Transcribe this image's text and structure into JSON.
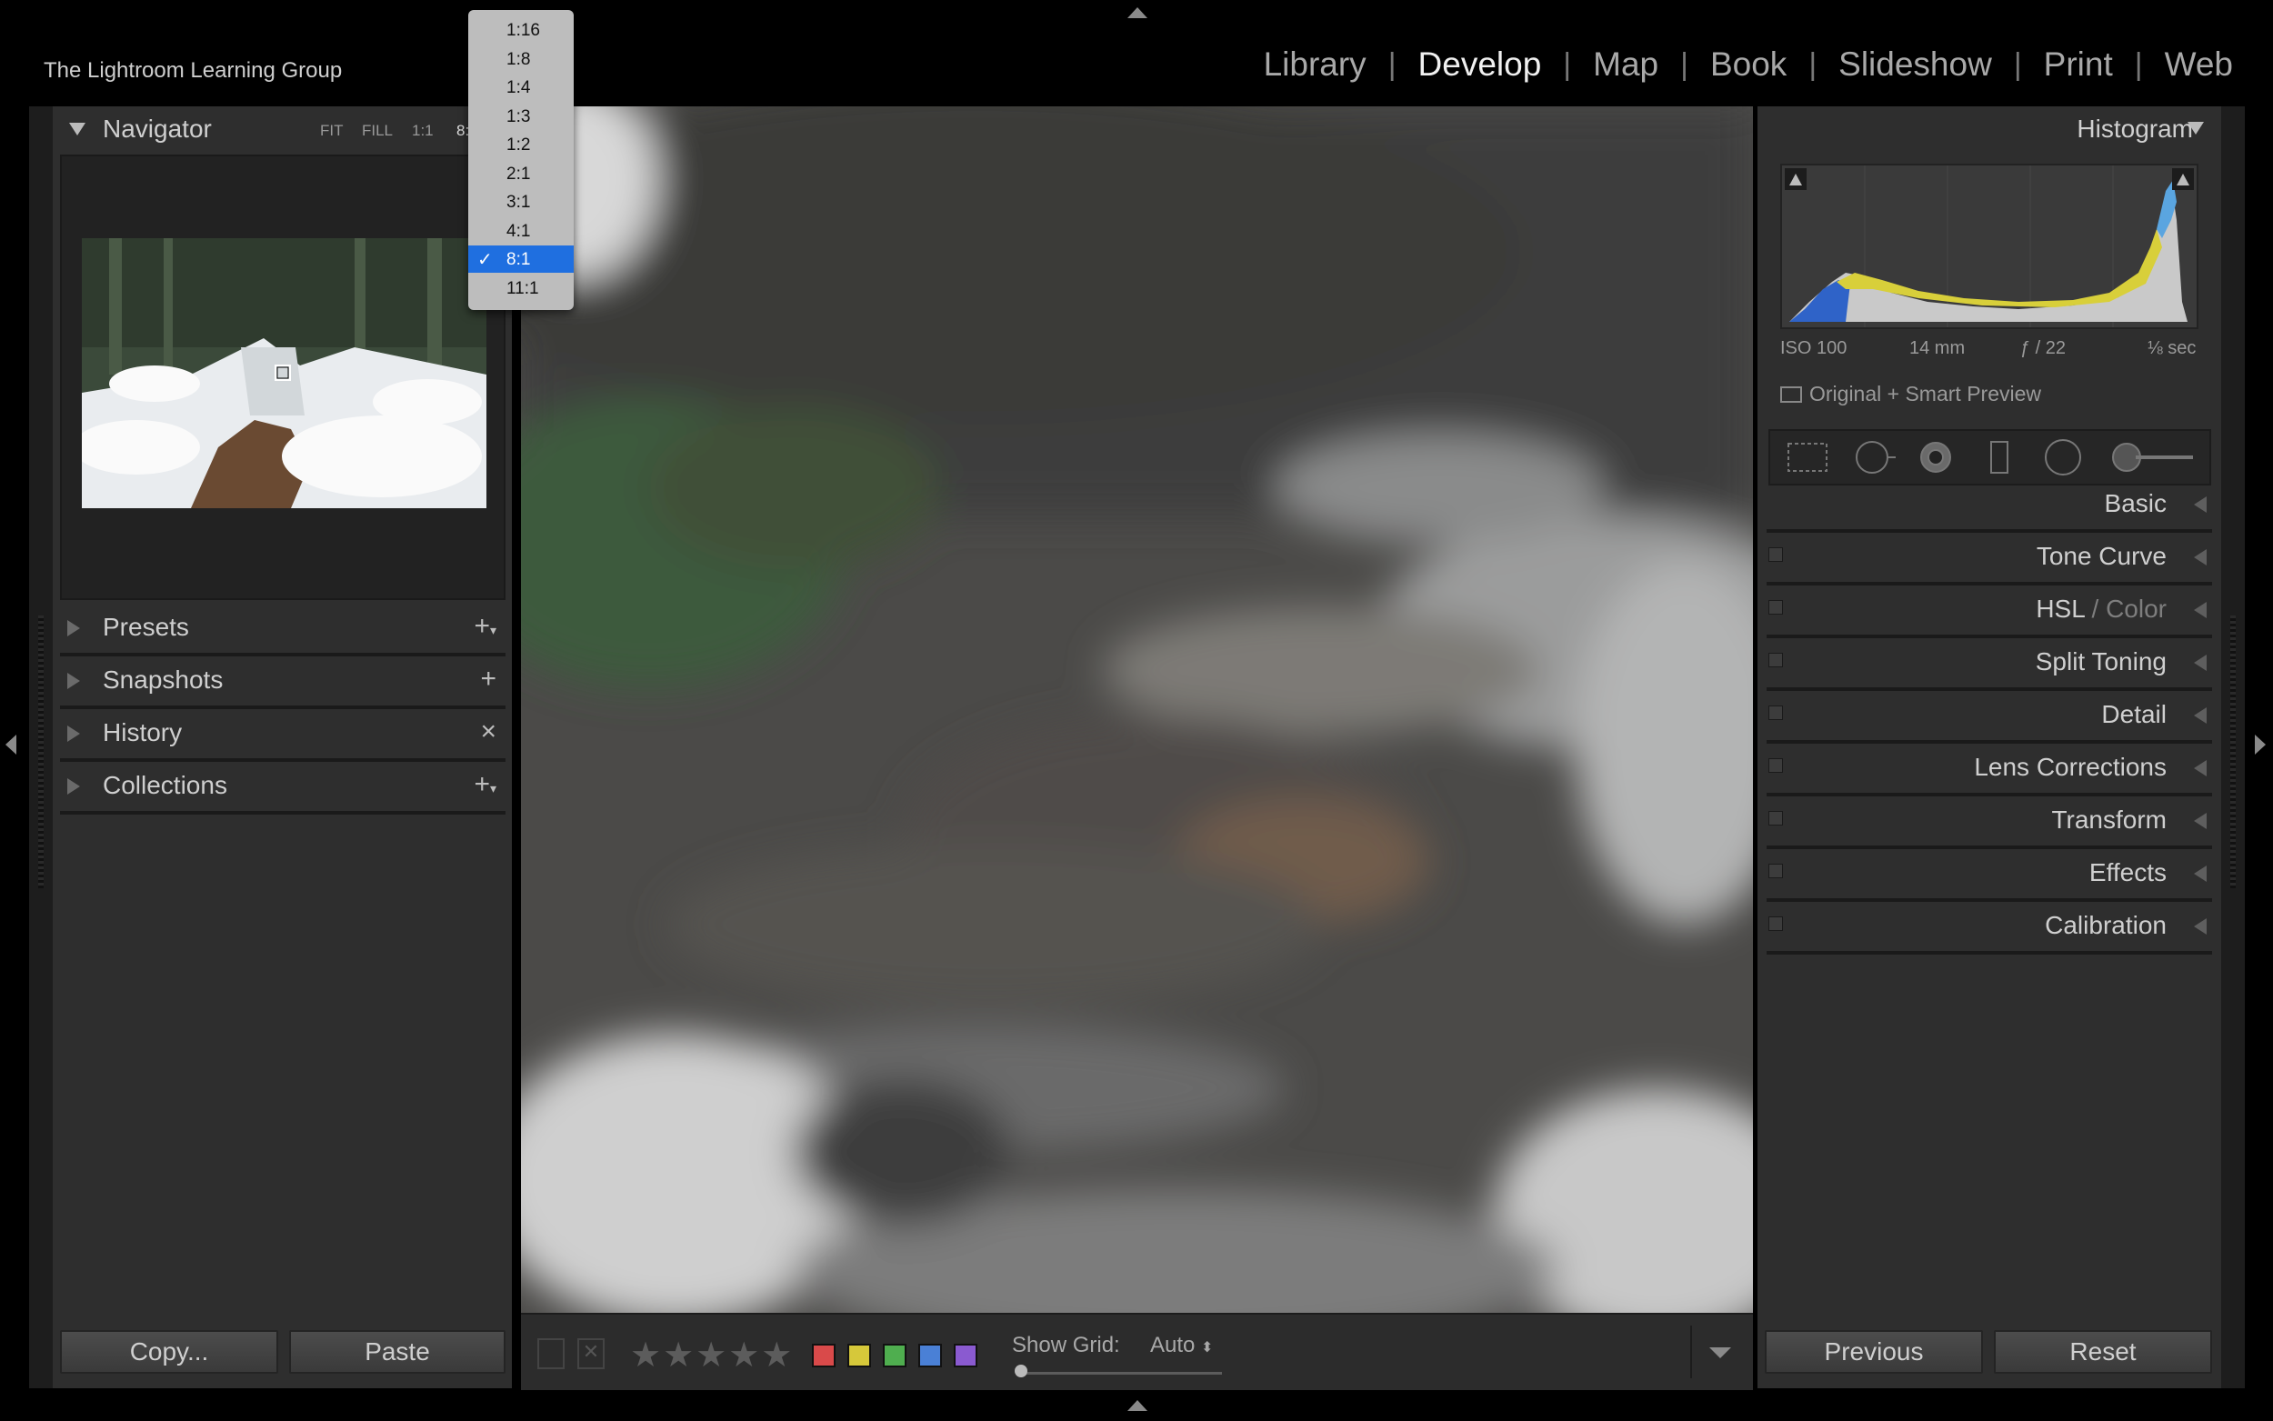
{
  "identity_plate": "The Lightroom Learning Group",
  "modules": [
    {
      "label": "Library",
      "active": false
    },
    {
      "label": "Develop",
      "active": true
    },
    {
      "label": "Map",
      "active": false
    },
    {
      "label": "Book",
      "active": false
    },
    {
      "label": "Slideshow",
      "active": false
    },
    {
      "label": "Print",
      "active": false
    },
    {
      "label": "Web",
      "active": false
    }
  ],
  "module_separator": "|",
  "navigator": {
    "title": "Navigator",
    "zoom_options": [
      "FIT",
      "FILL",
      "1:1",
      "8:"
    ]
  },
  "zoom_menu": {
    "items": [
      "1:16",
      "1:8",
      "1:4",
      "1:3",
      "1:2",
      "2:1",
      "3:1",
      "4:1",
      "8:1",
      "11:1"
    ],
    "selected": "8:1",
    "check": "✓"
  },
  "left_sections": [
    {
      "label": "Presets",
      "control": "+",
      "suffix": "▾"
    },
    {
      "label": "Snapshots",
      "control": "+",
      "suffix": ""
    },
    {
      "label": "History",
      "control": "×",
      "suffix": ""
    },
    {
      "label": "Collections",
      "control": "+",
      "suffix": "▾"
    }
  ],
  "left_buttons": {
    "copy": "Copy...",
    "paste": "Paste"
  },
  "histogram": {
    "title": "Histogram",
    "iso": "ISO 100",
    "focal": "14 mm",
    "aperture": "ƒ / 22",
    "shutter": "⅛ sec",
    "preview_status": "Original + Smart Preview"
  },
  "right_sections": [
    {
      "label": "Basic",
      "switch": false
    },
    {
      "label": "Tone Curve",
      "switch": true
    },
    {
      "label": "HSL",
      "label_extra": " / Color",
      "switch": true
    },
    {
      "label": "Split Toning",
      "switch": true
    },
    {
      "label": "Detail",
      "switch": true
    },
    {
      "label": "Lens Corrections",
      "switch": true
    },
    {
      "label": "Transform",
      "switch": true
    },
    {
      "label": "Effects",
      "switch": true
    },
    {
      "label": "Calibration",
      "switch": true
    }
  ],
  "right_buttons": {
    "previous": "Previous",
    "reset": "Reset"
  },
  "toolbar": {
    "stars": "★★★★★",
    "color_labels": [
      "#d94a4a",
      "#d6c83a",
      "#4fae4f",
      "#4a80d6",
      "#8a5ad0"
    ],
    "show_grid_label": "Show Grid:",
    "show_grid_value": "Auto",
    "stepper": "⬍"
  }
}
